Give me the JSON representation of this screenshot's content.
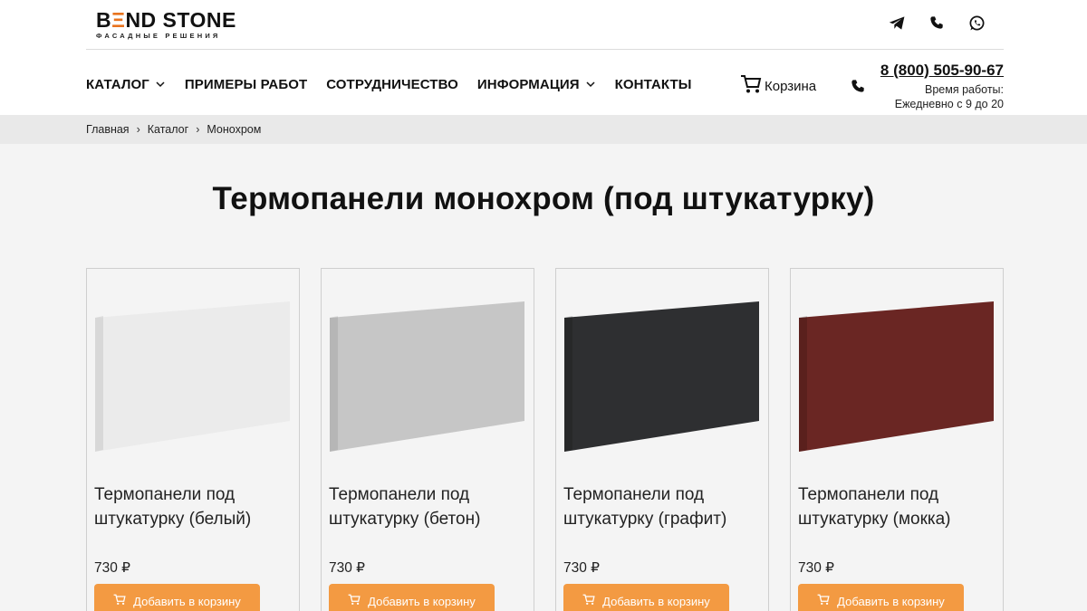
{
  "header": {
    "logo_main": "BEND STONE",
    "logo_sub": "ФАСАДНЫЕ РЕШЕНИЯ",
    "social_icons": [
      "telegram-icon",
      "phone-icon",
      "whatsapp-icon"
    ],
    "nav": [
      {
        "label": "КАТАЛОГ",
        "has_dropdown": true
      },
      {
        "label": "ПРИМЕРЫ РАБОТ",
        "has_dropdown": false
      },
      {
        "label": "СОТРУДНИЧЕСТВО",
        "has_dropdown": false
      },
      {
        "label": "ИНФОРМАЦИЯ",
        "has_dropdown": true
      },
      {
        "label": "КОНТАКТЫ",
        "has_dropdown": false
      }
    ],
    "cart_label": "Корзина",
    "phone": "8 (800) 505-90-67",
    "hours_label": "Время работы:",
    "hours_value": "Ежедневно с 9 до 20"
  },
  "breadcrumbs": [
    "Главная",
    "Каталог",
    "Монохром"
  ],
  "breadcrumb_separator": "›",
  "page_title": "Термопанели монохром (под штукатурку)",
  "products": [
    {
      "title": "Термопанели под штукатурку (белый)",
      "price": "730 ₽",
      "button": "Добавить в корзину",
      "color": "#ebebeb"
    },
    {
      "title": "Термопанели под штукатурку (бетон)",
      "price": "730 ₽",
      "button": "Добавить в корзину",
      "color": "#c6c6c6"
    },
    {
      "title": "Термопанели под штукатурку (графит)",
      "price": "730 ₽",
      "button": "Добавить в корзину",
      "color": "#2e2f31"
    },
    {
      "title": "Термопанели под штукатурку (мокка)",
      "price": "730 ₽",
      "button": "Добавить в корзину",
      "color": "#6a2623"
    }
  ],
  "colors": {
    "accent": "#f39a42",
    "logo_accent": "#e8731e"
  }
}
